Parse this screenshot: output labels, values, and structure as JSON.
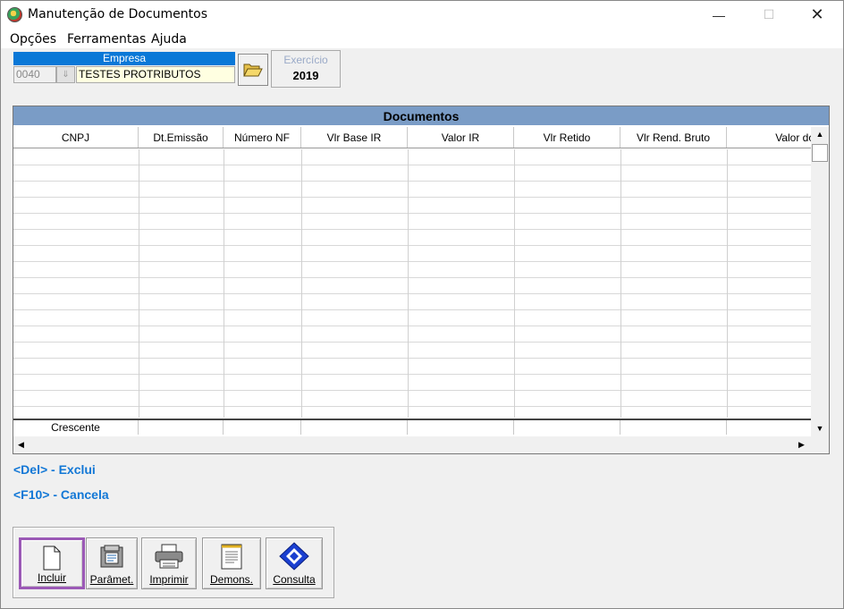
{
  "window": {
    "title": "Manutenção de Documentos",
    "minimize": "—",
    "maximize": "☐",
    "close": "✕"
  },
  "menu": [
    "Opções",
    "Ferramentas",
    "Ajuda"
  ],
  "empresa": {
    "header": "Empresa",
    "code": "0040",
    "name": "TESTES PROTRIBUTOS"
  },
  "exercicio": {
    "label": "Exercício",
    "value": "2019"
  },
  "grid": {
    "title": "Documentos",
    "columns": [
      "CNPJ",
      "Dt.Emissão",
      "Número NF",
      "Vlr Base IR",
      "Valor IR",
      "Vlr Retido",
      "Vlr Rend. Bruto",
      "Valor do"
    ],
    "footer_label": "Crescente",
    "rows": []
  },
  "hints": {
    "del": "<Del> - Exclui",
    "f10": "<F10> - Cancela"
  },
  "toolbar": {
    "incluir": "Incluir",
    "paramet": "Parâmet.",
    "imprimir": "Imprimir",
    "demons": "Demons.",
    "consulta": "Consulta"
  },
  "colors": {
    "accent": "#0a78d7",
    "grid_title": "#7a9cc6",
    "hint": "#1177d6",
    "selection": "#9b59b6"
  }
}
